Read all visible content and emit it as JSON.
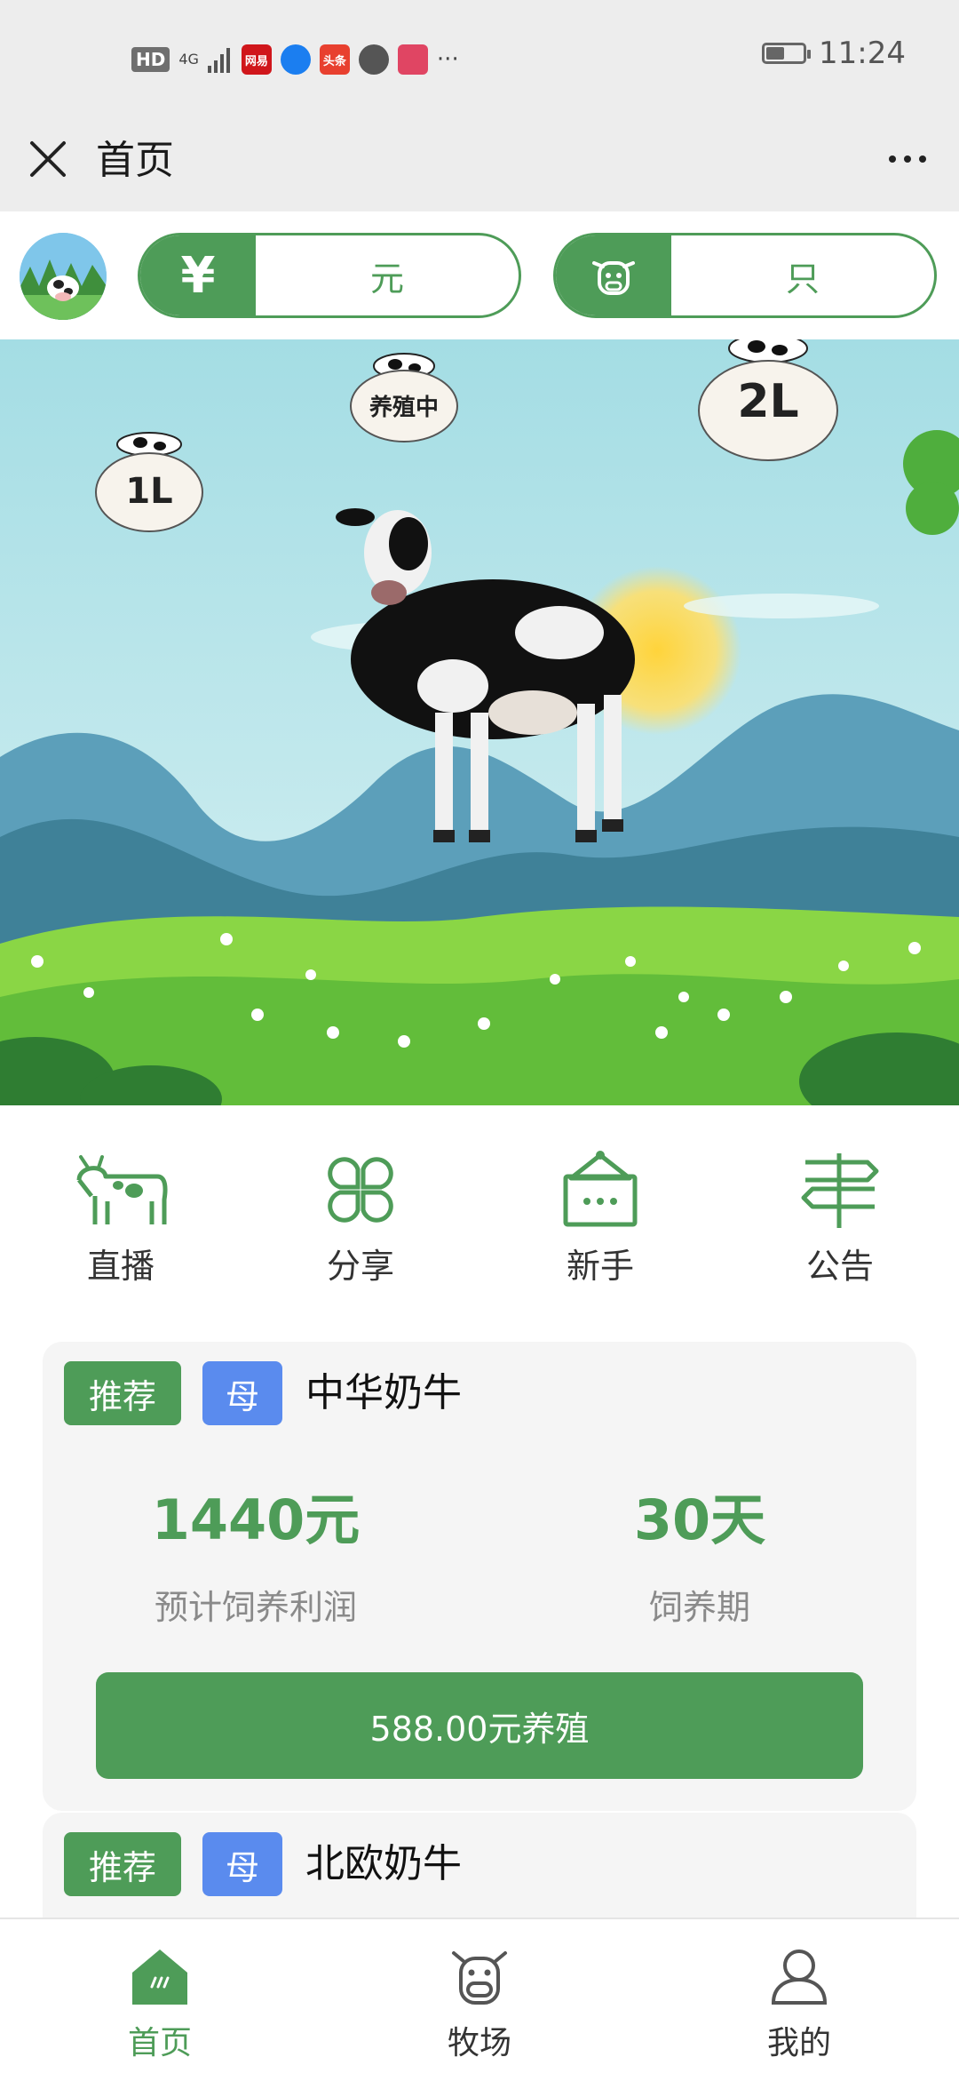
{
  "status_bar": {
    "hd": "HD",
    "network": "4G",
    "apps": [
      {
        "label": "网易",
        "color": "#d0161b"
      },
      {
        "label": "",
        "color": "#1b7ef0"
      },
      {
        "label": "头条",
        "color": "#e8402f"
      },
      {
        "label": "",
        "color": "#555555"
      },
      {
        "label": "",
        "color": "#e04563"
      }
    ],
    "more": "···",
    "time": "11:24"
  },
  "nav": {
    "title": "首页",
    "close_icon": "close-icon",
    "more_icon": "more-icon"
  },
  "balances": {
    "money": {
      "icon": "yen-icon",
      "symbol": "¥",
      "value": "元"
    },
    "cows": {
      "icon": "cow-face-icon",
      "value": "只"
    }
  },
  "scene": {
    "bubbles": [
      {
        "label": "养殖中"
      },
      {
        "label": "2L"
      },
      {
        "label": "1L"
      }
    ]
  },
  "quick_menu": [
    {
      "label": "直播",
      "icon": "cow-icon"
    },
    {
      "label": "分享",
      "icon": "clover-icon"
    },
    {
      "label": "新手",
      "icon": "sign-board-icon"
    },
    {
      "label": "公告",
      "icon": "signpost-icon"
    }
  ],
  "products": [
    {
      "tag": "推荐",
      "gender": "母",
      "name": "中华奶牛",
      "profit": "1440元",
      "profit_label": "预计饲养利润",
      "period": "30天",
      "period_label": "饲养期",
      "button": "588.00元养殖"
    },
    {
      "tag": "推荐",
      "gender": "母",
      "name": "北欧奶牛"
    }
  ],
  "tabs": [
    {
      "label": "首页",
      "icon": "home-icon",
      "active": true
    },
    {
      "label": "牧场",
      "icon": "ox-icon",
      "active": false
    },
    {
      "label": "我的",
      "icon": "user-icon",
      "active": false
    }
  ],
  "colors": {
    "primary": "#4e9c58",
    "blue_tag": "#5a8bee",
    "page_bg": "#ededed"
  }
}
